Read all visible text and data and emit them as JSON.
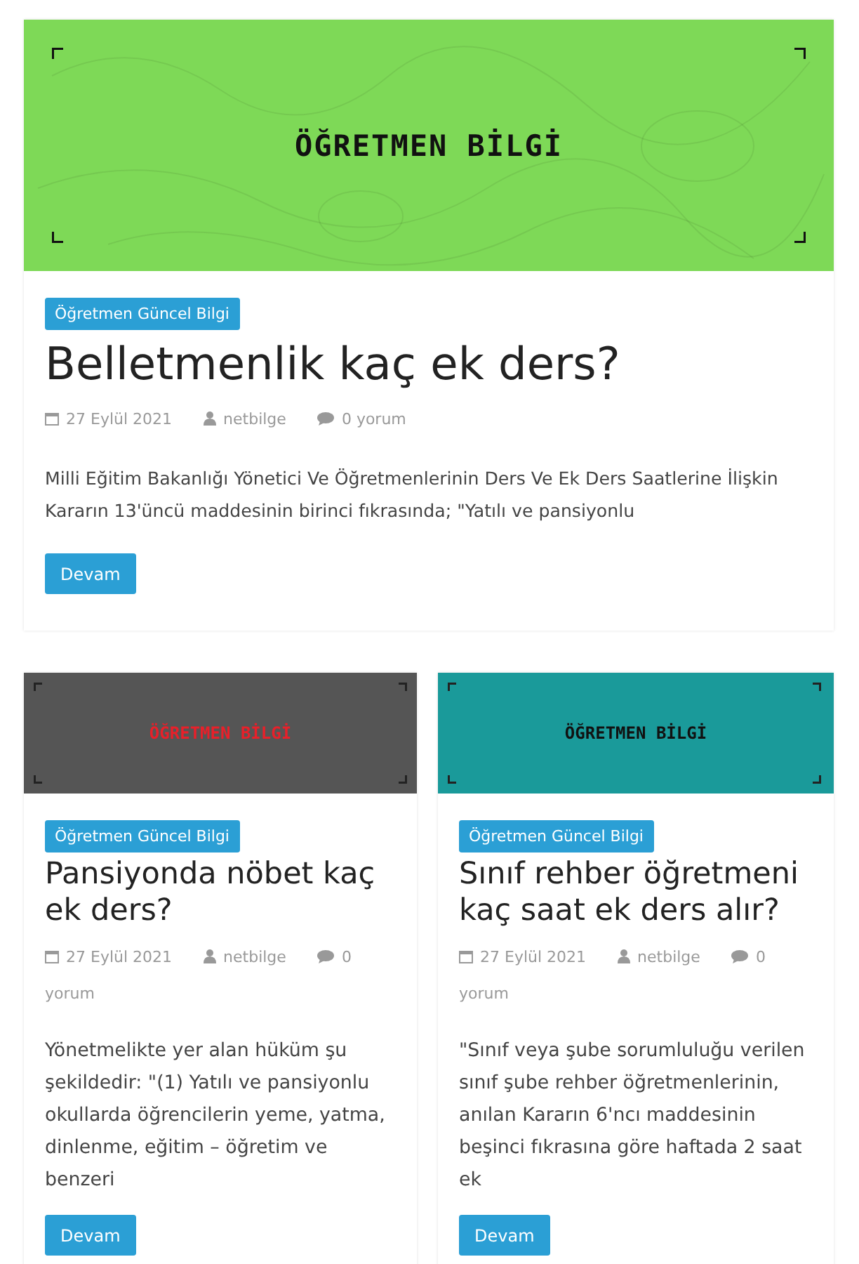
{
  "posts": [
    {
      "banner": {
        "color": "#7ed957",
        "label": {
          "text": "ÖĞRETMEN BİLGİ",
          "color": "#111111"
        }
      },
      "category": "Öğretmen Güncel Bilgi",
      "title": "Belletmenlik kaç ek ders?",
      "date": "27 Eylül 2021",
      "author": "netbilge",
      "comments": {
        "count": "0",
        "label": "yorum"
      },
      "excerpt": "Milli Eğitim Bakanlığı Yönetici Ve Öğretmenlerinin Ders Ve Ek Ders Saatlerine İlişkin Kararın 13'üncü maddesinin birinci fıkrasında; \"Yatılı ve pansiyonlu",
      "button": "Devam"
    },
    {
      "banner": {
        "color": "#555555",
        "label": {
          "text": "ÖĞRETMEN BİLGİ",
          "color": "#e8202a"
        }
      },
      "category": "Öğretmen Güncel Bilgi",
      "title": "Pansiyonda nöbet kaç ek ders?",
      "date": "27 Eylül 2021",
      "author": "netbilge",
      "comments": {
        "count": "0",
        "label": "yorum"
      },
      "excerpt": "Yönetmelikte yer alan hüküm şu şekildedir: \"(1) Yatılı ve pansiyonlu okullarda öğrencilerin yeme, yatma, dinlenme, eğitim – öğretim ve benzeri",
      "button": "Devam"
    },
    {
      "banner": {
        "color": "#1a9a9a",
        "label": {
          "text": "ÖĞRETMEN BİLGİ",
          "color": "#111111"
        }
      },
      "category": "Öğretmen Güncel Bilgi",
      "title": "Sınıf rehber öğretmeni kaç saat ek ders alır?",
      "date": "27 Eylül 2021",
      "author": "netbilge",
      "comments": {
        "count": "0",
        "label": "yorum"
      },
      "excerpt": "\"Sınıf veya şube sorumluluğu verilen sınıf şube rehber öğretmenlerinin, anılan Kararın 6'ncı maddesinin beşinci fıkrasına göre haftada 2 saat ek",
      "button": "Devam"
    }
  ]
}
